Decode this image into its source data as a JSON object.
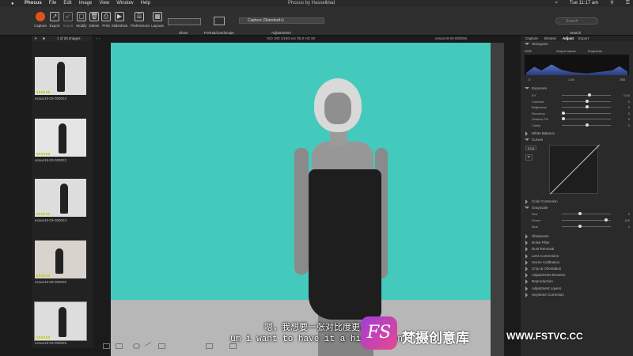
{
  "menubar": {
    "apple": "",
    "app_name": "Phocus",
    "items": [
      "File",
      "Edit",
      "Image",
      "View",
      "Window",
      "Help"
    ],
    "window_title": "Phocus by Hasselblad",
    "clock": "Tue 11:17 am"
  },
  "toolbar": {
    "buttons": [
      "Capture",
      "Export",
      "Import",
      "Modify",
      "Delete",
      "Print",
      "Slideshow",
      "Preferences",
      "Layouts"
    ],
    "show_label": "Show",
    "portrait_landscape_label": "Portrait/Landscape",
    "adjustments_value": "Capture (Standard+)",
    "adjustments_label": "Adjustments",
    "search_placeholder": "Search",
    "search_label": "Search"
  },
  "browser": {
    "count": "1 of 26 images",
    "thumbnails": [
      {
        "label": "essue19-03-000023"
      },
      {
        "label": "essue19-03-000022"
      },
      {
        "label": "essue19-03-000024"
      },
      {
        "label": "essue19-03-000025"
      },
      {
        "label": "essue19-03-000026"
      }
    ]
  },
  "viewer": {
    "info": "ISO 100  1/180 sec  f/8.0  HC 80",
    "filename": "essue19-03-000026"
  },
  "panel": {
    "tabs": [
      "Capture",
      "Browse",
      "Adjust",
      "Export"
    ],
    "active_tab": "Adjust",
    "histogram": {
      "title": "Histogram",
      "mode": "RGB",
      "option1": "Output values",
      "option2": "Endpoints",
      "scale_left": "0",
      "scale_right": "255",
      "mid": "1.00"
    },
    "exposure": {
      "title": "Exposure",
      "sliders": [
        {
          "label": "EV",
          "value": "0.00",
          "pos": 0.55
        },
        {
          "label": "Contrast",
          "value": "0",
          "pos": 0.5
        },
        {
          "label": "Brightness",
          "value": "0",
          "pos": 0.5
        },
        {
          "label": "Recovery",
          "value": "0",
          "pos": 0.0
        },
        {
          "label": "Shadow Fill",
          "value": "0",
          "pos": 0.0
        },
        {
          "label": "Clarity",
          "value": "0",
          "pos": 0.5
        }
      ]
    },
    "white_balance": "White Balance",
    "curves": {
      "title": "Curves",
      "mode": "RGB"
    },
    "color_correction": "Color Correction",
    "grayscale": {
      "title": "Grayscale",
      "sliders": [
        {
          "label": "Red",
          "value": "0",
          "pos": 0.35
        },
        {
          "label": "Green",
          "value": "100",
          "pos": 0.9
        },
        {
          "label": "Blue",
          "value": "0",
          "pos": 0.35
        }
      ]
    },
    "sections": [
      "Sharpness",
      "Noise Filter",
      "Dust Removal",
      "Lens Corrections",
      "Scene Calibration",
      "Crop & Orientation",
      "Adjustments Browser",
      "Reproduction",
      "Adjustment Layers",
      "Keystone Correction"
    ]
  },
  "overlay": {
    "subtitle_cn": "嗯，我想要一张对比度更高",
    "subtitle_en": "um i want to have it a higher con",
    "watermark_logo": "FS",
    "watermark_text": "梵摄创意库",
    "watermark_url": "WWW.FSTVC.CC"
  }
}
